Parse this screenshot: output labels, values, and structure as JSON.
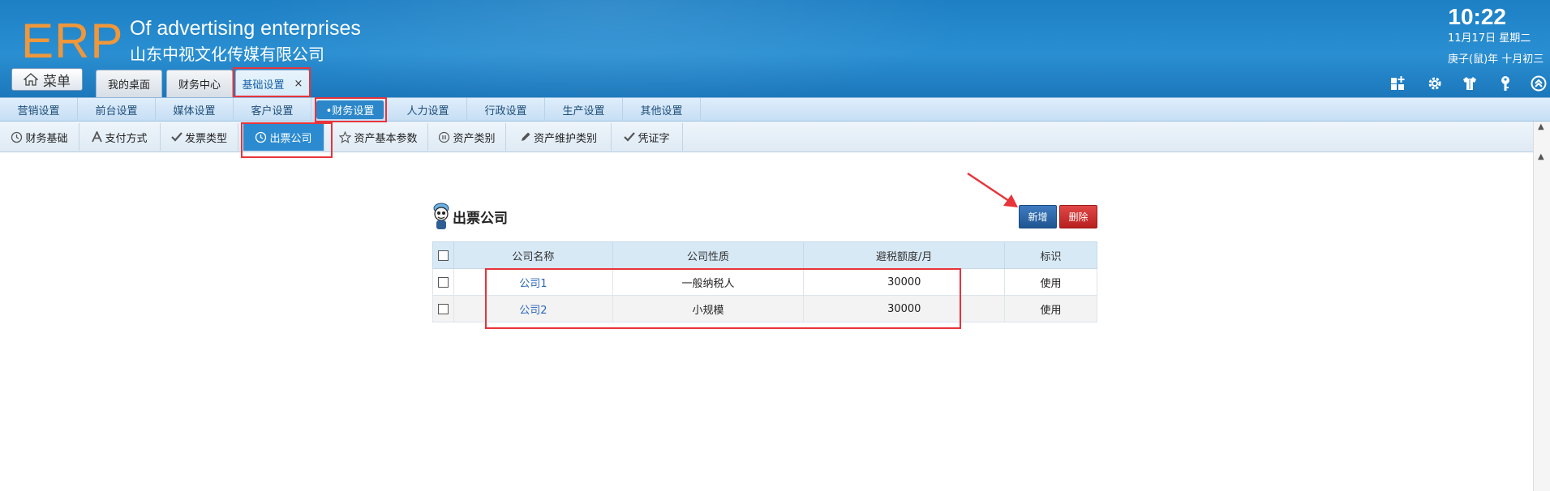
{
  "header": {
    "logo": "ERP",
    "company_en": "Of advertising enterprises",
    "company_cn": "山东中视文化传媒有限公司",
    "clock": "10:22",
    "date_line1": "11月17日 星期二",
    "date_line2": "庚子(鼠)年 十月初三",
    "menu_label": "菜单",
    "menu_icon": "home-icon",
    "tabs": [
      {
        "label": "我的桌面"
      },
      {
        "label": "财务中心"
      },
      {
        "label": "基础设置",
        "close": "×"
      }
    ],
    "tool_icons": [
      "dashboard-icon",
      "gear-icon",
      "shirt-icon",
      "key-icon",
      "chevron-up-icon"
    ]
  },
  "categories": [
    {
      "label": "营销设置"
    },
    {
      "label": "前台设置"
    },
    {
      "label": "媒体设置"
    },
    {
      "label": "客户设置"
    },
    {
      "label": "•财务设置"
    },
    {
      "label": "人力设置"
    },
    {
      "label": "行政设置"
    },
    {
      "label": "生产设置"
    },
    {
      "label": "其他设置"
    }
  ],
  "subtabs": [
    {
      "label": "财务基础",
      "icon": "clock-icon"
    },
    {
      "label": "支付方式",
      "icon": "font-a-icon"
    },
    {
      "label": "发票类型",
      "icon": "check-icon"
    },
    {
      "label": "出票公司",
      "icon": "clock-icon"
    },
    {
      "label": "资产基本参数",
      "icon": "star-icon"
    },
    {
      "label": "资产类别",
      "icon": "pause-circle-icon"
    },
    {
      "label": "资产维护类别",
      "icon": "pencil-icon"
    },
    {
      "label": "凭证字",
      "icon": "check-icon"
    }
  ],
  "panel": {
    "title": "出票公司",
    "add_label": "新增",
    "delete_label": "删除"
  },
  "table": {
    "headers": [
      "公司名称",
      "公司性质",
      "避税额度/月",
      "标识"
    ],
    "rows": [
      {
        "name": "公司1",
        "type": "一般纳税人",
        "quota": "30000",
        "flag": "使用"
      },
      {
        "name": "公司2",
        "type": "小规模",
        "quota": "30000",
        "flag": "使用"
      }
    ]
  },
  "colors": {
    "header_blue": "#2a8fd2",
    "logo_orange": "#f0973a",
    "active_blue": "#2c8bd0",
    "add_blue": "#1e5592",
    "delete_red": "#c52b2b",
    "highlight_red": "#e8343a"
  }
}
